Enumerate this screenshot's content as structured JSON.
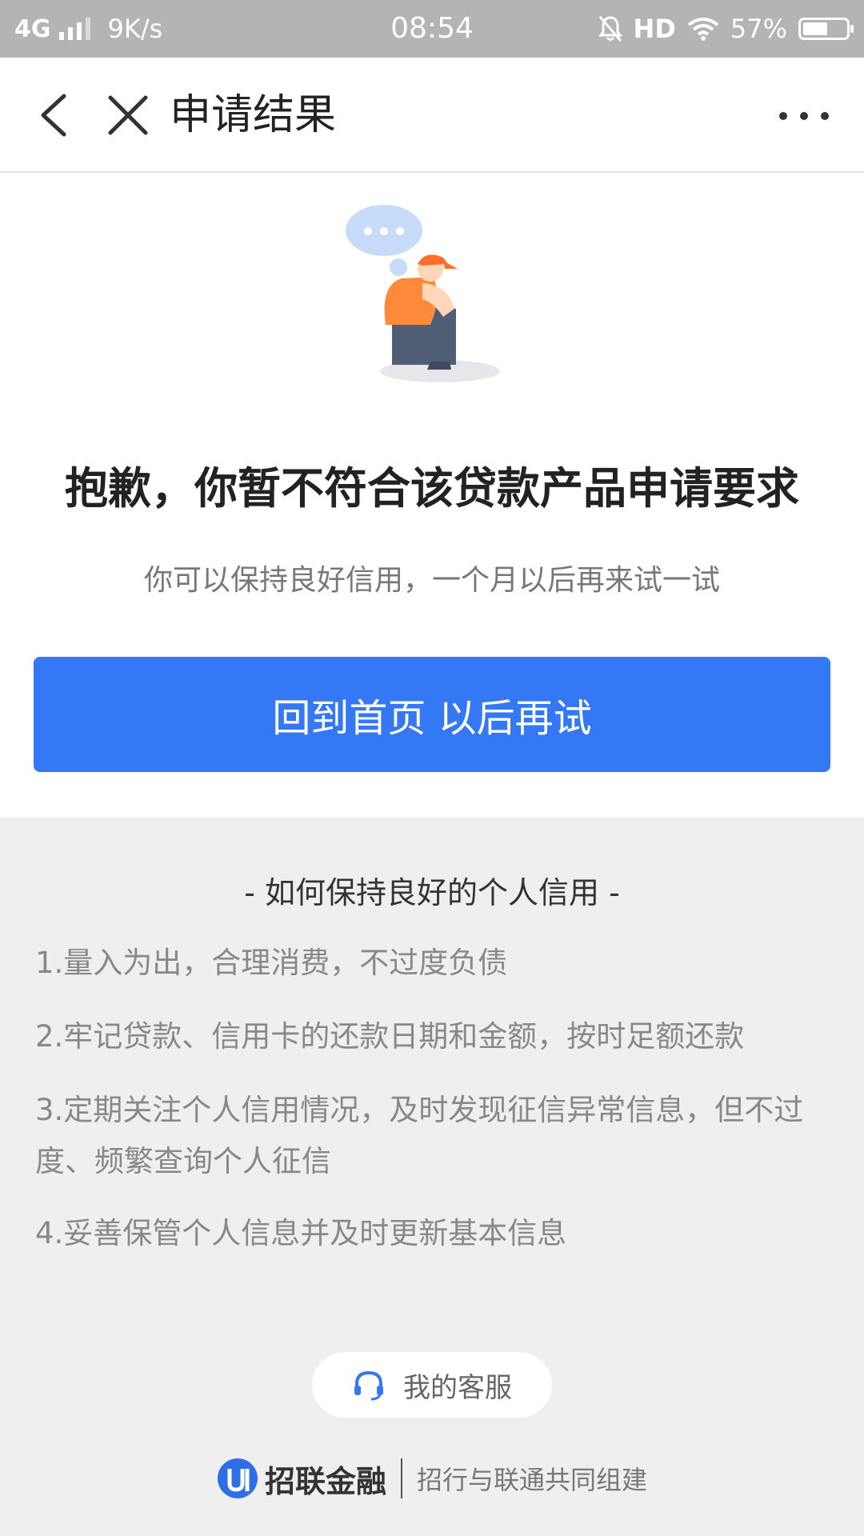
{
  "status_bar": {
    "network": "4G",
    "speed": "9K/s",
    "time": "08:54",
    "hd": "HD",
    "battery": "57%",
    "battery_level": 0.57
  },
  "nav": {
    "title": "申请结果",
    "back_icon": "chevron-left-icon",
    "close_icon": "close-icon",
    "more_icon": "more-dots-icon"
  },
  "result": {
    "headline": "抱歉，你暂不符合该贷款产品申请要求",
    "subline": "你可以保持良好信用，一个月以后再来试一试",
    "button_label": "回到首页 以后再试"
  },
  "tips": {
    "title": "- 如何保持良好的个人信用 -",
    "items": [
      "1.量入为出，合理消费，不过度负债",
      "2.牢记贷款、信用卡的还款日期和金额，按时足额还款",
      "3.定期关注个人信用情况，及时发现征信异常信息，但不过度、频繁查询个人征信",
      "4.妥善保管个人信息并及时更新基本信息"
    ]
  },
  "support": {
    "label": "我的客服",
    "icon": "headset-icon"
  },
  "footer": {
    "brand": "招联金融",
    "slogan": "招行与联通共同组建"
  },
  "colors": {
    "primary": "#3478f6",
    "background": "#efefef",
    "status_bar": "#b4b4b4"
  }
}
